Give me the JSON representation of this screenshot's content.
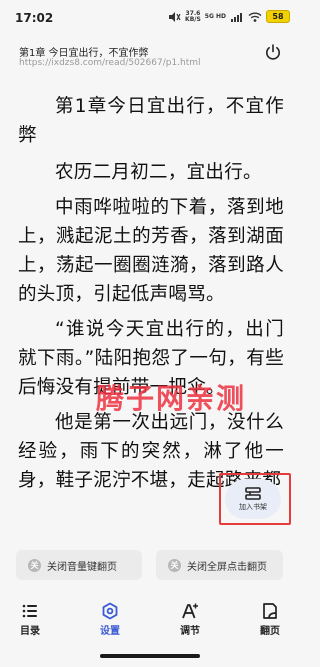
{
  "status_bar": {
    "time": "17:02",
    "net_speed": "37.6",
    "net_speed_unit": "KB/S",
    "signal_label": "5G HD",
    "battery": "58"
  },
  "header": {
    "chapter_title": "第1章 今日宜出行，不宜作弊",
    "url": "https://ixdzs8.com/read/502667/p1.html"
  },
  "content": {
    "title": "第1章今日宜出行，不宜作弊",
    "paragraphs": [
      "农历二月初二，宜出行。",
      "中雨哗啦啦的下着，落到地上，溅起泥土的芳香，落到湖面上，荡起一圈圈涟漪，落到路人的头顶，引起低声喝骂。",
      "“谁说今天宜出行的，出门就下雨。”陆阳抱怨了一句，有些后悔没有提前带一把伞。",
      "他是第一次出远门，没什么经验，雨下的突然，淋了他一身，鞋子泥泞不堪，走起路来都"
    ]
  },
  "watermark": "腾子网亲测",
  "add_shelf": {
    "label": "加入书架"
  },
  "bottom_panel": {
    "volume_toggle": {
      "icon": "关",
      "label": "关闭音量键翻页"
    },
    "fullscreen_toggle": {
      "icon": "关",
      "label": "关闭全屏点击翻页"
    },
    "nav": [
      {
        "label": "目录",
        "icon": "list-icon"
      },
      {
        "label": "设置",
        "icon": "settings-icon"
      },
      {
        "label": "调节",
        "icon": "font-adjust-icon"
      },
      {
        "label": "翻页",
        "icon": "page-turn-icon"
      }
    ],
    "active_color": "#3b5bd6"
  }
}
